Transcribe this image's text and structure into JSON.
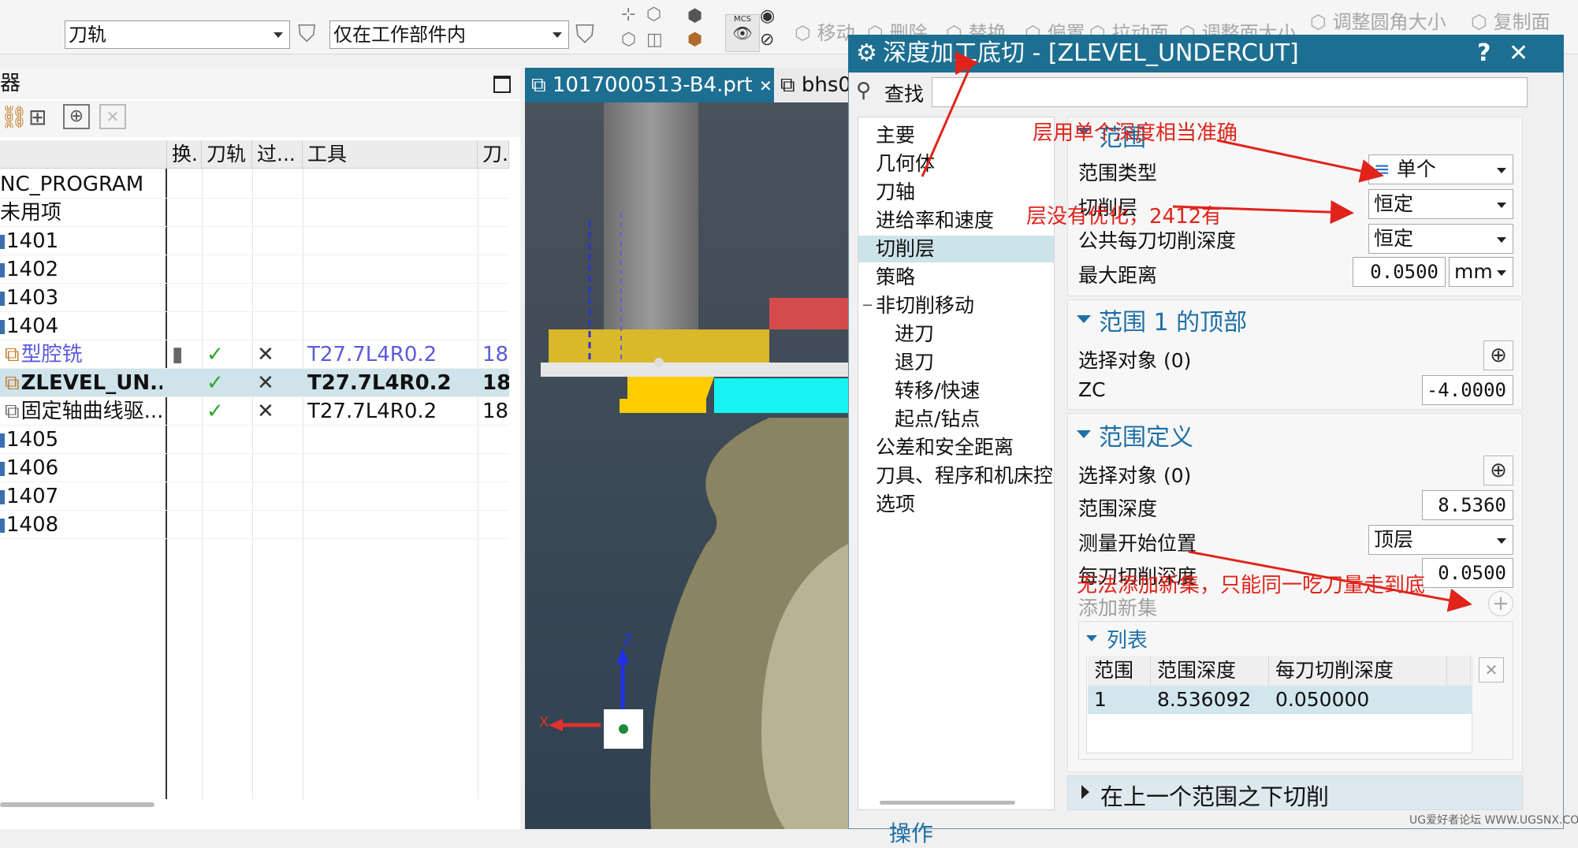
{
  "toolbar": {
    "filter_combo": "刀轨",
    "scope_combo": "仅在工作部件内",
    "ghost_items": [
      "移动",
      "删除",
      "替换",
      "偏置",
      "拉动面",
      "调整面大小",
      "调整圆角大小",
      "复制面"
    ],
    "mcs_label": "MCS"
  },
  "navigator": {
    "title": "器",
    "columns": [
      "",
      "换.",
      "刀轨",
      "过...",
      "工具",
      "刀."
    ],
    "rows": [
      {
        "name": "NC_PROGRAM",
        "change": "",
        "path": "",
        "over": "",
        "tool": "",
        "num": ""
      },
      {
        "name": "未用项",
        "change": "",
        "path": "",
        "over": "",
        "tool": "",
        "num": ""
      },
      {
        "name": "1401",
        "change": "",
        "path": "",
        "over": "",
        "tool": "",
        "num": ""
      },
      {
        "name": "1402",
        "change": "",
        "path": "",
        "over": "",
        "tool": "",
        "num": ""
      },
      {
        "name": "1403",
        "change": "",
        "path": "",
        "over": "",
        "tool": "",
        "num": ""
      },
      {
        "name": "1404",
        "change": "",
        "path": "",
        "over": "",
        "tool": "",
        "num": ""
      },
      {
        "name": "型腔铣",
        "change": "",
        "path": "✓",
        "over": "✕",
        "tool": "T27.7L4R0.2",
        "num": "18"
      },
      {
        "name": "ZLEVEL_UN...",
        "change": "",
        "path": "✓",
        "over": "✕",
        "tool": "T27.7L4R0.2",
        "num": "18"
      },
      {
        "name": "固定轴曲线驱...",
        "change": "",
        "path": "✓",
        "over": "✕",
        "tool": "T27.7L4R0.2",
        "num": "18"
      },
      {
        "name": "1405",
        "change": "",
        "path": "",
        "over": "",
        "tool": "",
        "num": ""
      },
      {
        "name": "1406",
        "change": "",
        "path": "",
        "over": "",
        "tool": "",
        "num": ""
      },
      {
        "name": "1407",
        "change": "",
        "path": "",
        "over": "",
        "tool": "",
        "num": ""
      },
      {
        "name": "1408",
        "change": "",
        "path": "",
        "over": "",
        "tool": "",
        "num": ""
      }
    ]
  },
  "tabs": {
    "active": "1017000513-B4.prt",
    "second": "bhs0"
  },
  "axis": {
    "z": "Z",
    "x": "X"
  },
  "dialog": {
    "title": "深度加工底切 - [ZLEVEL_UNDERCUT]",
    "help": "?",
    "close": "✕",
    "search_label": "查找",
    "tree": [
      "主要",
      "几何体",
      "刀轴",
      "进给率和速度",
      "切削层",
      "策略",
      "非切削移动",
      "进刀",
      "退刀",
      "转移/快速",
      "起点/钻点",
      "公差和安全距离",
      "刀具、程序和机床控",
      "选项"
    ],
    "range_section": {
      "title": "范围",
      "range_type_label": "范围类型",
      "range_type_value": "单个",
      "cut_levels_label": "切削层",
      "cut_levels_value": "恒定",
      "common_depth_label": "公共每刀切削深度",
      "common_depth_value": "恒定",
      "max_dist_label": "最大距离",
      "max_dist_value": "0.0500",
      "max_dist_unit": "mm"
    },
    "top_section": {
      "title": "范围 1 的顶部",
      "select_label": "选择对象 (0)",
      "zc_label": "ZC",
      "zc_value": "-4.0000"
    },
    "def_section": {
      "title": "范围定义",
      "select_label": "选择对象 (0)",
      "depth_label": "范围深度",
      "depth_value": "8.5360",
      "measure_label": "测量开始位置",
      "measure_value": "顶层",
      "per_cut_label": "每刀切削深度",
      "per_cut_value": "0.0500",
      "add_set_label": "添加新集"
    },
    "list": {
      "title": "列表",
      "headers": [
        "范围",
        "范围深度",
        "每刀切削深度"
      ],
      "rows": [
        [
          "1",
          "8.536092",
          "0.050000"
        ]
      ]
    },
    "below_section": "在上一个范围之下切削",
    "ops_label": "操作"
  },
  "annotations": {
    "a1": "层用单个深度相当准确",
    "a2": "层没有优化，2412有",
    "a3": "无法添加新集，只能同一吃刀量走到底"
  },
  "watermark": "UG爱好者论坛 WWW.UGSNX.COM",
  "colors": {
    "title_bar": "#1d6f92",
    "accent": "#1e6fa6",
    "annotation": "#e0241b",
    "selection": "#cfe3ea"
  }
}
